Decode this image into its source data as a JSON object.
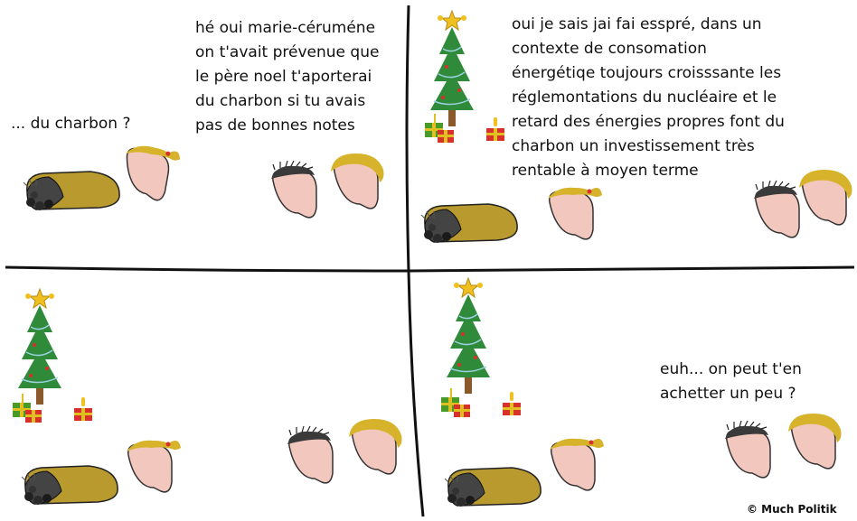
{
  "panels": [
    {
      "speech": "... du charbon ?"
    },
    {
      "speech": "hé oui marie-céruméne\non t'avait prévenue que\nle père noel t'aporterai\ndu charbon si tu avais\npas de bonnes notes"
    },
    {
      "speech": "oui je sais jai fai esspré, dans un\ncontexte de consomation\nénergétiqe toujours croisssante les\nréglemontations du nucléaire et le\nretard des énergies propres font du\ncharbon un investissement très\nrentable à moyen terme"
    },
    {
      "speech": "euh... on peut t'en\nachetter un peu ?"
    }
  ],
  "credit": "© Much Politik",
  "colors": {
    "skin": "#f2c7bd",
    "blonde": "#d6b32a",
    "dark_hair": "#3a3a3a",
    "coal_bag": "#b89a2e",
    "tree": "#2f8a3a",
    "trunk": "#8a5a2a",
    "star": "#f0c020",
    "gift_red": "#d8302a",
    "gift_green": "#4a9a2a",
    "lines": "#111111"
  }
}
